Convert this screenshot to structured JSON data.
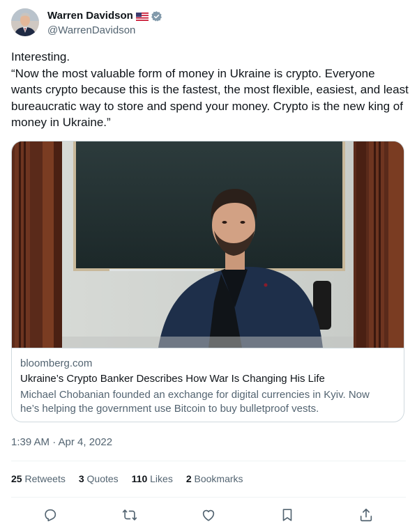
{
  "author": {
    "name": "Warren Davidson",
    "handle": "@WarrenDavidson",
    "flag_icon": "us-flag-icon",
    "verified_icon": "verified-badge-icon",
    "verified_color": "#829aab"
  },
  "tweet": {
    "lines": [
      "Interesting.",
      "“Now the most valuable form of money in Ukraine is crypto. Everyone wants crypto because this is the fastest, the most flexible, easiest, and least bureaucratic way to store and spend your money. Crypto is the new king of money in Ukraine.”"
    ]
  },
  "card": {
    "domain": "bloomberg.com",
    "title": "Ukraine’s Crypto Banker Describes How War Is Changing His Life",
    "description": "Michael Chobanian founded an exchange for digital currencies in Kyiv. Now he’s helping the government use Bitcoin to buy bulletproof vests."
  },
  "timestamp": "1:39 AM · Apr 4, 2022",
  "stats": {
    "retweets_count": "25",
    "retweets_label": "Retweets",
    "quotes_count": "3",
    "quotes_label": "Quotes",
    "likes_count": "110",
    "likes_label": "Likes",
    "bookmarks_count": "2",
    "bookmarks_label": "Bookmarks"
  },
  "actions": {
    "reply_icon": "reply-icon",
    "retweet_icon": "retweet-icon",
    "like_icon": "like-icon",
    "bookmark_icon": "bookmark-icon",
    "share_icon": "share-icon"
  },
  "colors": {
    "text_primary": "#0f1419",
    "text_secondary": "#536471",
    "border": "#cfd9de",
    "divider": "#eff3f4"
  }
}
